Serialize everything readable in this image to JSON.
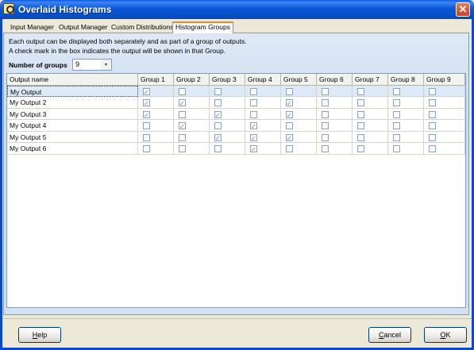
{
  "window": {
    "title": "Overlaid Histograms",
    "close_glyph": "✕"
  },
  "tabs": [
    {
      "label": "Input Manager"
    },
    {
      "label": "Output Manager"
    },
    {
      "label": "Custom Distributions"
    },
    {
      "label": "Histogram Groups",
      "selected": true
    }
  ],
  "info": {
    "line1": "Each output can be displayed both separately and as part of a group of outputs.",
    "line2": "A check mark in the box indicates the output will be shown in that Group."
  },
  "groups": {
    "label": "Number of groups",
    "value": "9",
    "arrow": "▾"
  },
  "grid": {
    "columns": [
      "Output name",
      "Group 1",
      "Group 2",
      "Group 3",
      "Group 4",
      "Group 5",
      "Group 6",
      "Group 7",
      "Group 8",
      "Group 9"
    ],
    "rows": [
      {
        "name": "My Output",
        "checks": [
          true,
          false,
          false,
          false,
          false,
          false,
          false,
          false,
          false
        ]
      },
      {
        "name": "My Output 2",
        "checks": [
          true,
          true,
          false,
          false,
          true,
          false,
          false,
          false,
          false
        ]
      },
      {
        "name": "My Output 3",
        "checks": [
          true,
          false,
          true,
          false,
          true,
          false,
          false,
          false,
          false
        ]
      },
      {
        "name": "My Output 4",
        "checks": [
          false,
          true,
          false,
          true,
          false,
          false,
          false,
          false,
          false
        ]
      },
      {
        "name": "My Output 5",
        "checks": [
          false,
          false,
          true,
          true,
          true,
          false,
          false,
          false,
          false
        ]
      },
      {
        "name": "My Output 6",
        "checks": [
          false,
          false,
          false,
          true,
          false,
          false,
          false,
          false,
          false
        ]
      }
    ]
  },
  "buttons": {
    "help": {
      "label_ul": "H",
      "label_rest": "elp"
    },
    "cancel": {
      "label_ul": "C",
      "label_rest": "ancel"
    },
    "ok": {
      "label_ul": "O",
      "label_rest": "K"
    }
  },
  "colors": {
    "titlebar": "#0a58d8",
    "tab_highlight": "#e68b2c",
    "panel": "#d3e0f2"
  }
}
